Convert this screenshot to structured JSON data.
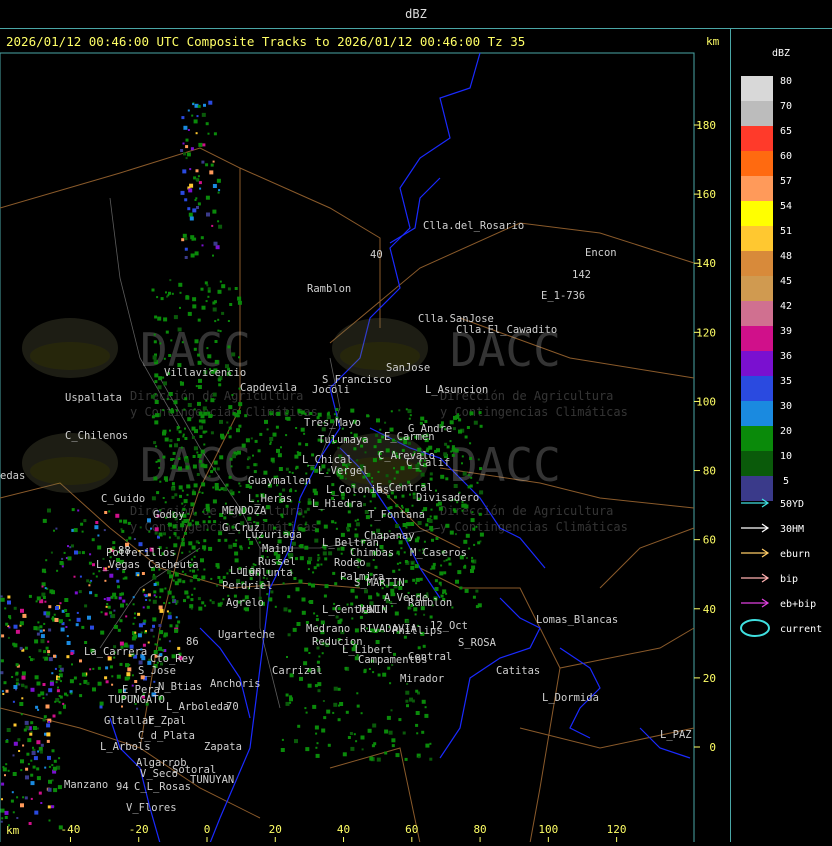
{
  "panel_title": "dBZ",
  "header": "2026/01/12 00:46:00 UTC Composite Tracks to 2026/01/12 00:46:00 Tz 35",
  "km_top": "km",
  "km_bottom": "km",
  "y_ticks": [
    "180",
    "160",
    "140",
    "120",
    "100",
    "80",
    "60",
    "40",
    "20",
    "0"
  ],
  "x_ticks": [
    "-40",
    "-20",
    "0",
    "20",
    "40",
    "60",
    "80",
    "100",
    "120"
  ],
  "colorbar_title": "dBZ",
  "colorbar": [
    {
      "label": "80",
      "color": "#d8d8d8"
    },
    {
      "label": "70",
      "color": "#bcbcbc"
    },
    {
      "label": "65",
      "color": "#ff3a2a"
    },
    {
      "label": "60",
      "color": "#ff6a10"
    },
    {
      "label": "57",
      "color": "#ff9a5a"
    },
    {
      "label": "54",
      "color": "#ffff00"
    },
    {
      "label": "51",
      "color": "#ffc830"
    },
    {
      "label": "48",
      "color": "#d88a3a"
    },
    {
      "label": "45",
      "color": "#d09a50"
    },
    {
      "label": "42",
      "color": "#d07090"
    },
    {
      "label": "39",
      "color": "#d0108a"
    },
    {
      "label": "36",
      "color": "#7a10d0"
    },
    {
      "label": "35",
      "color": "#2a4ae0"
    },
    {
      "label": "30",
      "color": "#1a8ae0"
    },
    {
      "label": "20",
      "color": "#0a8a0a"
    },
    {
      "label": "10",
      "color": "#0a5a0a"
    },
    {
      "label": "5",
      "color": "#3a3a8a"
    }
  ],
  "legend": [
    {
      "label": "50YD",
      "color": "#40e0e0"
    },
    {
      "label": "30HM",
      "color": "#ffffff"
    },
    {
      "label": "eburn",
      "color": "#ffcc66"
    },
    {
      "label": "bip",
      "color": "#ffb0b0"
    },
    {
      "label": "eb+bip",
      "color": "#e040e0"
    }
  ],
  "legend_current": {
    "label": "current",
    "color": "#40e0e0"
  },
  "watermark": {
    "brand": "DACC",
    "line1": "Dirección de Agricultura",
    "line2": "y Contingencias Climáticas"
  },
  "places": [
    {
      "name": "Clla.del_Rosario",
      "x": -5,
      "y": -3
    },
    {
      "name": "Encon",
      "x": 0,
      "y": 0
    },
    {
      "name": "142",
      "x": 0,
      "y": 0
    },
    {
      "name": "E_1-736",
      "x": 0,
      "y": 0
    },
    {
      "name": "Rамblon",
      "x": 0,
      "y": 0
    }
  ]
}
